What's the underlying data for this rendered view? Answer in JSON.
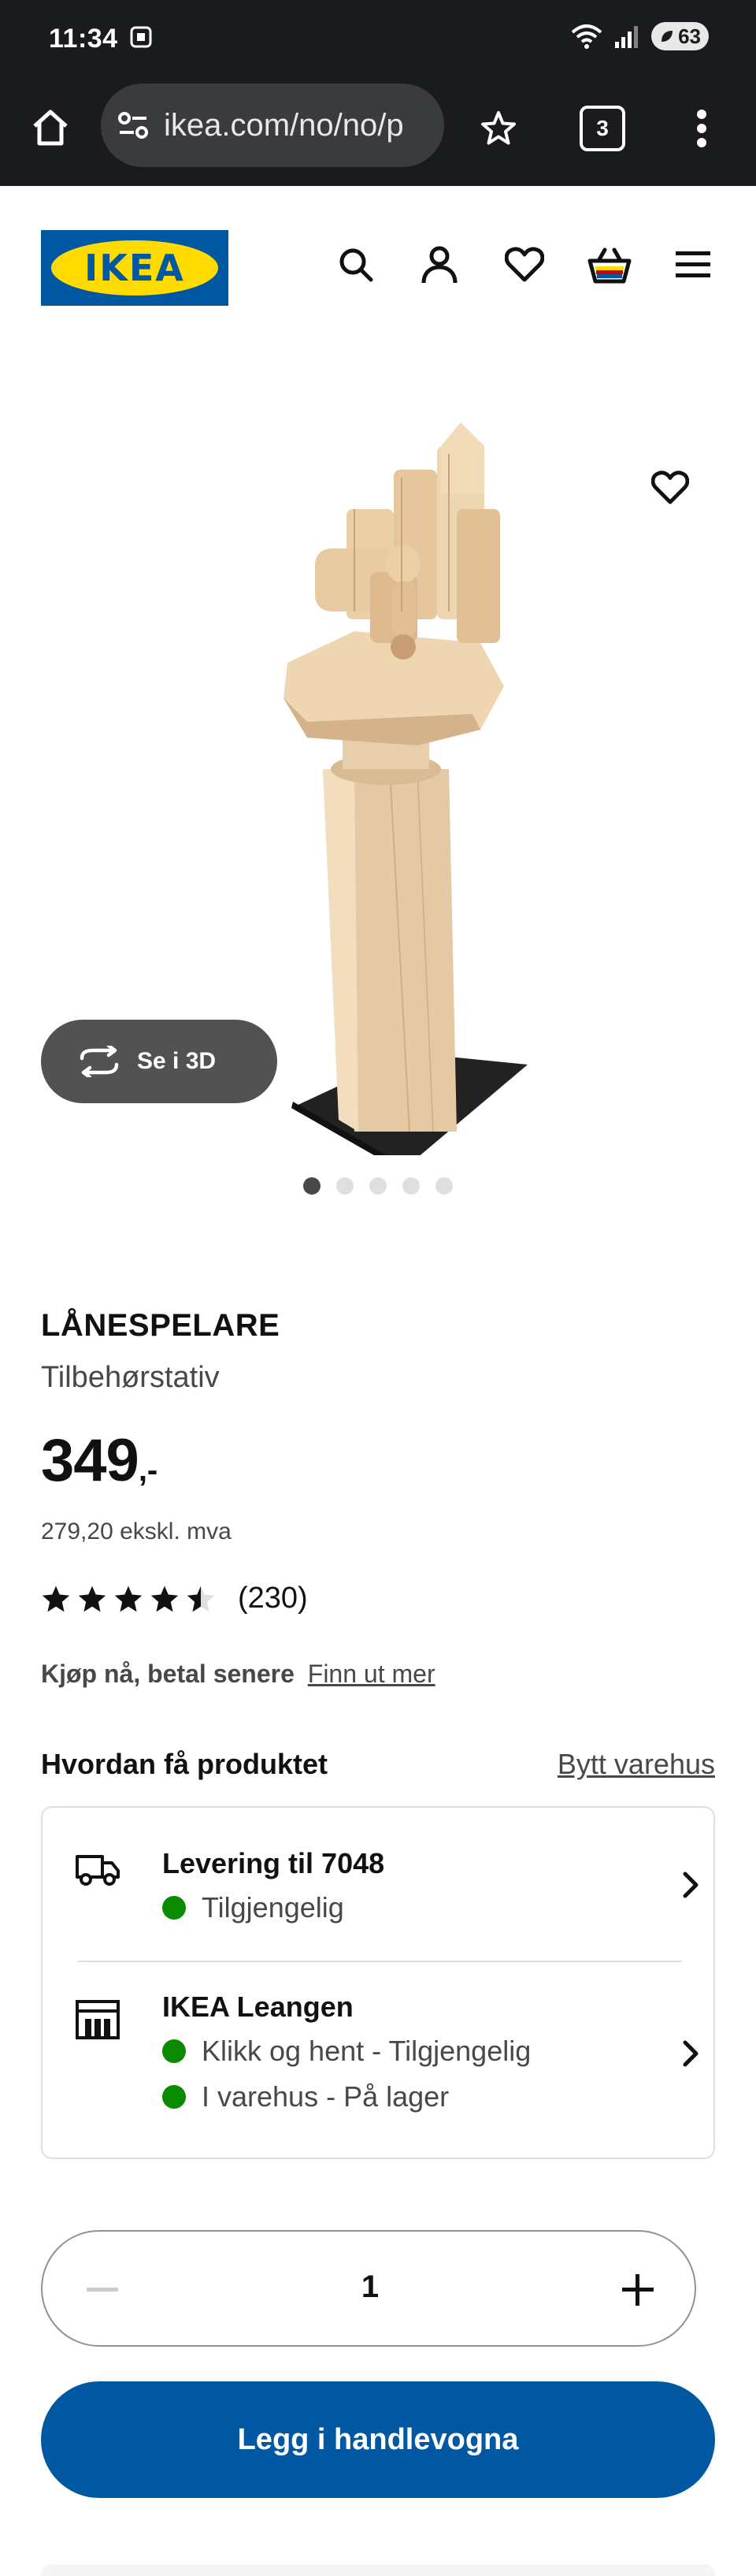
{
  "status_bar": {
    "time": "11:34",
    "battery": "63"
  },
  "browser": {
    "url": "ikea.com/no/no/p",
    "tab_count": "3"
  },
  "brand": {
    "logo_text": "IKEA",
    "primary_color": "#0058a3",
    "logo_yellow": "#ffdb00"
  },
  "header_icons": [
    "search-icon",
    "user-icon",
    "heart-icon",
    "shopping-bag-icon",
    "hamburger-menu-icon"
  ],
  "gallery": {
    "view_3d_label": "Se i 3D",
    "image_count": 5,
    "active_index": 0
  },
  "product": {
    "name": "LÅNESPELARE",
    "description": "Tilbehørstativ",
    "price": "349",
    "price_suffix": ",-",
    "price_ex_vat": "279,20 ekskl. mva",
    "rating": 4.5,
    "review_count": "(230)"
  },
  "bnpl": {
    "text": "Kjøp nå, betal senere",
    "link": "Finn ut mer"
  },
  "availability": {
    "heading": "Hvordan få produktet",
    "change_store": "Bytt varehus",
    "delivery_title": "Levering til 7048",
    "delivery_status": "Tilgjengelig",
    "store_title": "IKEA Leangen",
    "store_status_1": "Klikk og hent - Tilgjengelig",
    "store_status_2": "I varehus - På lager",
    "status_color": "#0a8a00"
  },
  "quantity": {
    "value": "1"
  },
  "cta": {
    "label": "Legg i handlevogna"
  }
}
